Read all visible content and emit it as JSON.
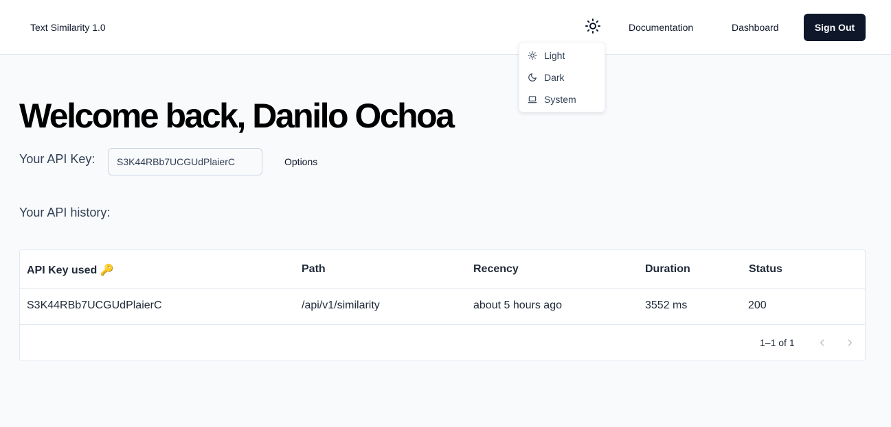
{
  "header": {
    "brand": "Text Similarity 1.0",
    "theme_toggle_icon": "sun-icon",
    "nav": {
      "documentation": "Documentation",
      "dashboard": "Dashboard"
    },
    "sign_out_label": "Sign Out"
  },
  "theme_menu": {
    "items": [
      {
        "label": "Light",
        "icon": "sun-icon"
      },
      {
        "label": "Dark",
        "icon": "moon-icon"
      },
      {
        "label": "System",
        "icon": "laptop-icon"
      }
    ]
  },
  "main": {
    "welcome": "Welcome back, Danilo Ochoa",
    "api_key_label": "Your API Key:",
    "api_key_value": "S3K44RBb7UCGUdPlaierC",
    "options_label": "Options",
    "history_label": "Your API history:"
  },
  "table": {
    "columns": [
      "API Key used 🔑",
      "Path",
      "Recency",
      "Duration",
      "Status"
    ],
    "rows": [
      [
        "S3K44RBb7UCGUdPlaierC",
        "/api/v1/similarity",
        "about 5 hours ago",
        "3552 ms",
        "200"
      ]
    ],
    "pagination": "1–1 of 1"
  },
  "colors": {
    "primary": "#0f172a",
    "background": "#f8fafc",
    "border": "#e2e8f0"
  }
}
